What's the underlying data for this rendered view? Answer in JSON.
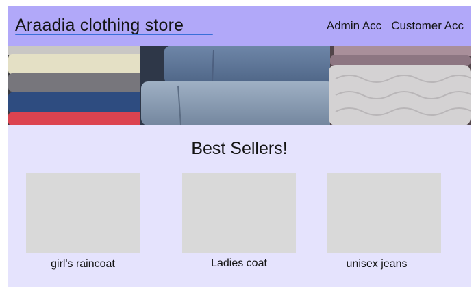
{
  "header": {
    "logo": "Araadia clothing store",
    "nav": [
      "Admin Acc",
      "Customer Acc"
    ]
  },
  "hero": {
    "image": "stacked folded clothes and jeans"
  },
  "section": {
    "title": "Best Sellers!"
  },
  "products": [
    {
      "label": "girl's raincoat"
    },
    {
      "label": "Ladies coat"
    },
    {
      "label": "unisex jeans"
    }
  ],
  "colors": {
    "header_bg": "#b1a8f9",
    "page_bg": "#e5e3fd",
    "placeholder": "#d9d9d9",
    "link_underline": "#3a6fd8"
  }
}
